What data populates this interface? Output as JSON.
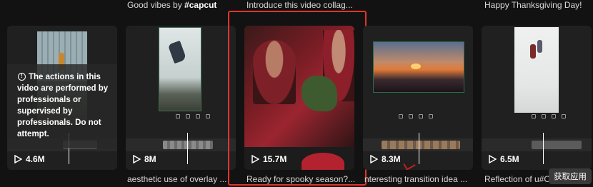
{
  "top_captions": [
    {
      "text": "Good vibes by ",
      "tag": "#capcut"
    },
    {
      "text": "Introduce this video collag..."
    },
    {
      "text": "Happy Thanksgiving Day! "
    }
  ],
  "warning": {
    "text": "The actions in this video are performed by professionals or supervised by professionals. Do not attempt."
  },
  "cards": [
    {
      "views": "4.6M"
    },
    {
      "views": "8M"
    },
    {
      "views": "15.7M"
    },
    {
      "views": "8.3M"
    },
    {
      "views": "6.5M"
    }
  ],
  "bottom_captions": [
    {
      "text": "aesthetic use of overlay ..."
    },
    {
      "text": "Ready for spooky season?..."
    },
    {
      "text": "nteresting transition idea ..."
    },
    {
      "text": "Reflection of u#C"
    }
  ],
  "badge": {
    "label": "获取应用"
  },
  "icons": [
    "play-icon",
    "warning-icon"
  ],
  "colors": {
    "background": "#121212",
    "selection_border": "#e0352b"
  }
}
